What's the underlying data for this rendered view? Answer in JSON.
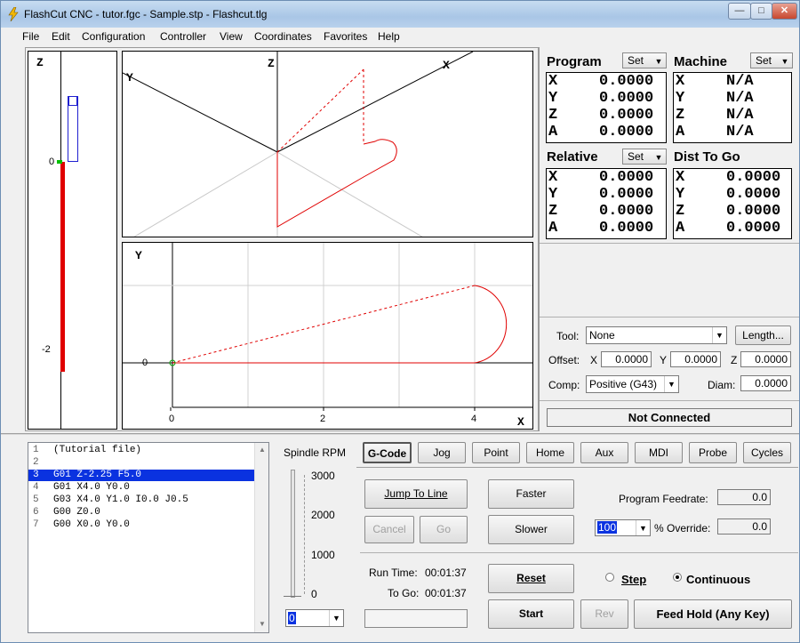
{
  "window": {
    "title": "FlashCut CNC - tutor.fgc - Sample.stp - Flashcut.tlg"
  },
  "menu": [
    "File",
    "Edit",
    "Configuration",
    "Controller",
    "View",
    "Coordinates",
    "Favorites",
    "Help"
  ],
  "zgauge": {
    "axis_label": "Z",
    "tick_top": "0",
    "tick_bottom": "-2"
  },
  "iso_view": {
    "label_z": "Z",
    "label_x": "X",
    "label_y": "Y"
  },
  "xy_view": {
    "label_y": "Y",
    "label_x": "X",
    "tick_x": [
      "0",
      "2",
      "4"
    ],
    "tick_y": "0"
  },
  "dro": {
    "program": {
      "title": "Program",
      "set": "Set",
      "rows": [
        [
          "X",
          "0.0000"
        ],
        [
          "Y",
          "0.0000"
        ],
        [
          "Z",
          "0.0000"
        ],
        [
          "A",
          "0.0000"
        ]
      ]
    },
    "machine": {
      "title": "Machine",
      "set": "Set",
      "rows": [
        [
          "X",
          "N/A"
        ],
        [
          "Y",
          "N/A"
        ],
        [
          "Z",
          "N/A"
        ],
        [
          "A",
          "N/A"
        ]
      ]
    },
    "relative": {
      "title": "Relative",
      "set": "Set",
      "rows": [
        [
          "X",
          "0.0000"
        ],
        [
          "Y",
          "0.0000"
        ],
        [
          "Z",
          "0.0000"
        ],
        [
          "A",
          "0.0000"
        ]
      ]
    },
    "dist": {
      "title": "Dist To Go",
      "rows": [
        [
          "X",
          "0.0000"
        ],
        [
          "Y",
          "0.0000"
        ],
        [
          "Z",
          "0.0000"
        ],
        [
          "A",
          "0.0000"
        ]
      ]
    }
  },
  "tool": {
    "tool_label": "Tool:",
    "tool_value": "None",
    "length_btn": "Length...",
    "offset_label": "Offset:",
    "x_label": "X",
    "x_value": "0.0000",
    "y_label": "Y",
    "y_value": "0.0000",
    "z_label": "Z",
    "z_value": "0.0000",
    "comp_label": "Comp:",
    "comp_value": "Positive (G43)",
    "diam_label": "Diam:",
    "diam_value": "0.0000"
  },
  "status": "Not Connected",
  "gcode_lines": [
    [
      "1",
      "(Tutorial file)"
    ],
    [
      "2",
      ""
    ],
    [
      "3",
      "G01 Z-2.25 F5.0"
    ],
    [
      "4",
      "G01 X4.0 Y0.0"
    ],
    [
      "5",
      "G03 X4.0 Y1.0 I0.0 J0.5"
    ],
    [
      "6",
      "G00 Z0.0"
    ],
    [
      "7",
      "G00 X0.0 Y0.0"
    ]
  ],
  "selected_line": 3,
  "spindle": {
    "title": "Spindle RPM",
    "ticks": [
      "3000",
      "2000",
      "1000",
      "0"
    ],
    "value": "0"
  },
  "tabs": [
    "G-Code",
    "Jog",
    "Point",
    "Home",
    "Aux",
    "MDI",
    "Probe",
    "Cycles"
  ],
  "controls": {
    "jump": "Jump To Line",
    "cancel": "Cancel",
    "go": "Go",
    "faster": "Faster",
    "slower": "Slower",
    "feedrate_label": "Program Feedrate:",
    "feedrate_value": "0.0",
    "override_select": "100",
    "override_label": "% Override:",
    "override_value": "0.0",
    "run_time_label": "Run Time:",
    "run_time": "00:01:37",
    "to_go_label": "To Go:",
    "to_go": "00:01:37",
    "reset": "Reset",
    "start": "Start",
    "rev": "Rev",
    "step": "Step",
    "continuous": "Continuous",
    "feed_hold": "Feed Hold (Any Key)"
  }
}
